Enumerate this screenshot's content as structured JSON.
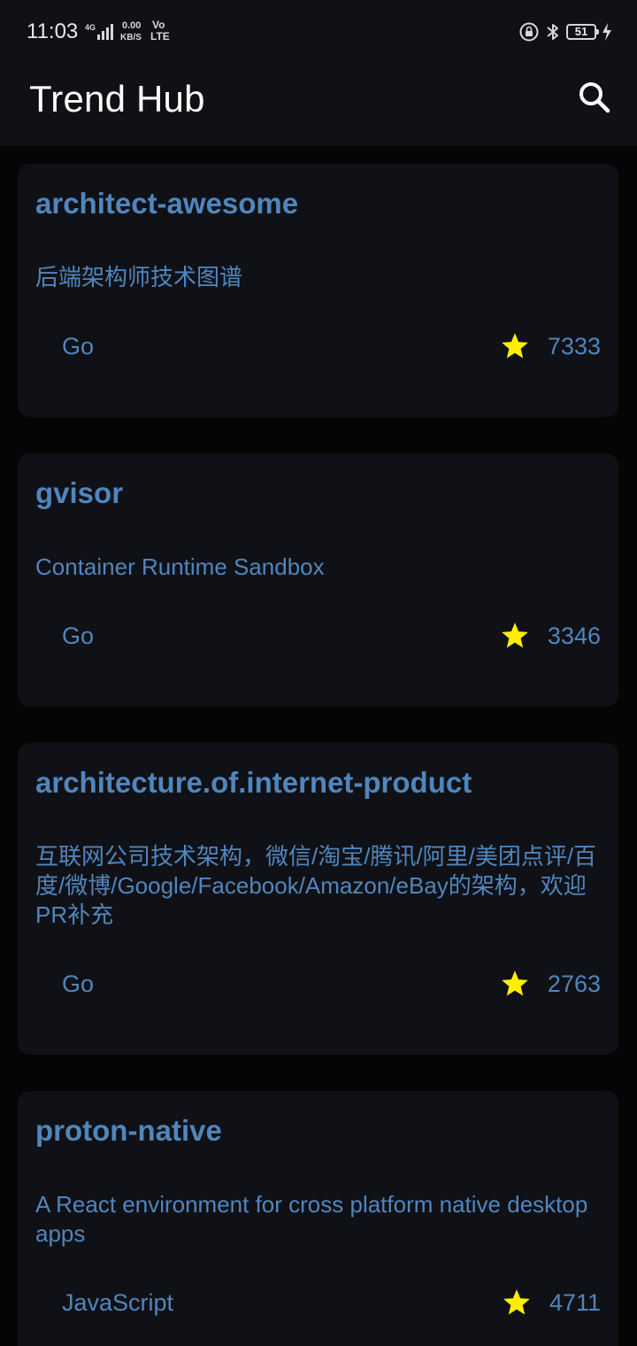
{
  "status_bar": {
    "time": "11:03",
    "network_label": "4G",
    "speed_value": "0.00",
    "speed_unit": "KB/S",
    "volte_top": "Vo",
    "volte_bottom": "LTE",
    "battery_level": "51",
    "icons": [
      "signal-icon",
      "lock-rotation-icon",
      "bluetooth-icon",
      "battery-icon",
      "charging-bolt-icon"
    ]
  },
  "app_bar": {
    "title": "Trend Hub",
    "search_icon": "search-icon"
  },
  "colors": {
    "background": "#050505",
    "bar": "#101114",
    "card": "#101116",
    "accent_text": "#4f86bd",
    "star": "#ffee00",
    "title_text": "#ffffff"
  },
  "repos": [
    {
      "name": "architect-awesome",
      "description": "后端架构师技术图谱",
      "language": "Go",
      "stars": "7333"
    },
    {
      "name": "gvisor",
      "description": "Container Runtime Sandbox",
      "language": "Go",
      "stars": "3346"
    },
    {
      "name": "architecture.of.internet-product",
      "description": "互联网公司技术架构，微信/淘宝/腾讯/阿里/美团点评/百度/微博/Google/Facebook/Amazon/eBay的架构，欢迎PR补充",
      "language": "Go",
      "stars": "2763"
    },
    {
      "name": "proton-native",
      "description": "A React environment for cross platform native desktop apps",
      "language": "JavaScript",
      "stars": "4711"
    }
  ]
}
